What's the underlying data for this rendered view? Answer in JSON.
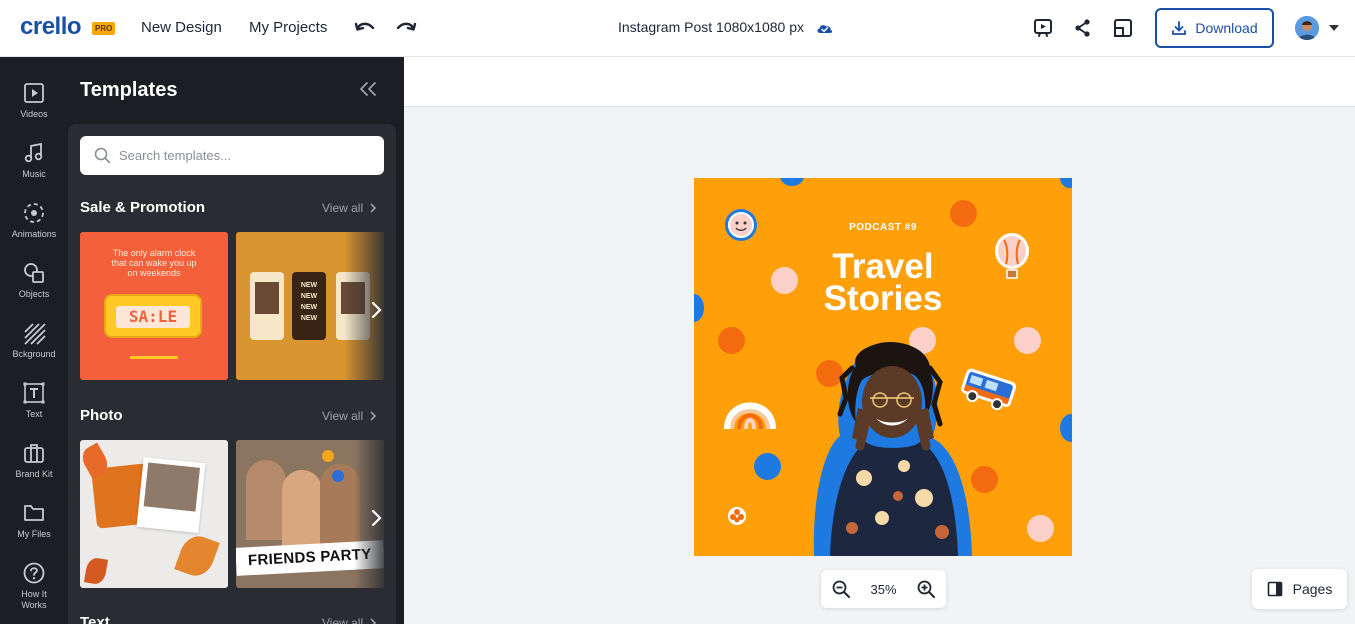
{
  "header": {
    "logo": "crello",
    "pro_badge": "PRO",
    "new_design": "New Design",
    "my_projects": "My Projects",
    "doc_title": "Instagram Post 1080x1080 px",
    "download_label": "Download",
    "icons": [
      "undo-icon",
      "redo-icon",
      "cloud-saved-icon",
      "preview-icon",
      "share-icon",
      "resize-icon",
      "download-icon"
    ]
  },
  "rail": {
    "items": [
      {
        "label": "Videos",
        "icon": "video-icon"
      },
      {
        "label": "Music",
        "icon": "music-icon"
      },
      {
        "label": "Animations",
        "icon": "animation-icon"
      },
      {
        "label": "Objects",
        "icon": "objects-icon"
      },
      {
        "label": "Bckground",
        "icon": "background-icon"
      },
      {
        "label": "Text",
        "icon": "text-icon"
      },
      {
        "label": "Brand Kit",
        "icon": "brand-kit-icon"
      },
      {
        "label": "My Files",
        "icon": "folder-icon"
      },
      {
        "label": "How It",
        "label2": "Works",
        "icon": "help-icon"
      }
    ]
  },
  "panel": {
    "title": "Templates",
    "search_placeholder": "Search templates...",
    "sections": [
      {
        "title": "Sale & Promotion",
        "view_all": "View all",
        "thumb1": {
          "line1": "The only alarm clock",
          "line2": "that can wake you up",
          "line3": "on weekends",
          "big": "SA:LE"
        },
        "thumb2": {
          "texts": [
            "NEW",
            "NEW",
            "NEW",
            "NEW"
          ]
        }
      },
      {
        "title": "Photo",
        "view_all": "View all",
        "thumb2": {
          "caption": "FRIENDS PARTY"
        }
      },
      {
        "title": "Text",
        "view_all": "View all"
      }
    ]
  },
  "canvas": {
    "podcast": "PODCAST #9",
    "headline1": "Travel",
    "headline2": "Stories",
    "zoom": "35%",
    "pages_label": "Pages"
  },
  "colors": {
    "brand": "#1a4fa8",
    "design_bg": "#ffa00a",
    "panel_bg": "#1c1e23",
    "dot_blue": "#1e7ae0",
    "dot_red": "#f46b0f",
    "dot_pink": "#fbd0c8"
  }
}
